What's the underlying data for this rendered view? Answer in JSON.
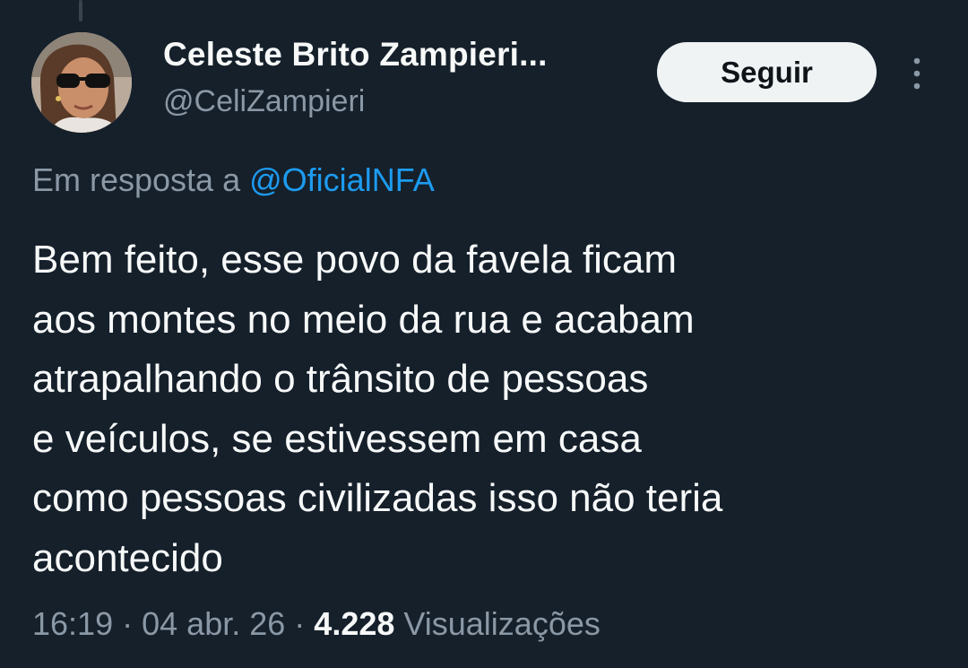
{
  "tweet": {
    "author": {
      "display_name": "Celeste Brito Zampieri...",
      "handle": "@CeliZampieri"
    },
    "follow_label": "Seguir",
    "reply": {
      "prefix": "Em resposta a",
      "mention": "@OficialNFA"
    },
    "text_lines": [
      "Bem feito, esse povo da favela ficam",
      "aos montes no meio da rua e acabam",
      "atrapalhando o trânsito de pessoas",
      "e veículos, se estivessem em casa",
      "como pessoas civilizadas isso não teria",
      "acontecido"
    ],
    "time": "16:19",
    "separator": "·",
    "date": "04 abr. 26",
    "views_count": "4.228",
    "views_label": "Visualizações"
  },
  "icons": {
    "more": "more-vertical-icon",
    "avatar": "profile-photo"
  },
  "colors": {
    "background": "#15202b",
    "primary_text": "#f7f9f9",
    "secondary_text": "#8b98a5",
    "link": "#1d9bf0",
    "follow_button_bg": "#eff3f4",
    "follow_button_text": "#0f1419"
  }
}
